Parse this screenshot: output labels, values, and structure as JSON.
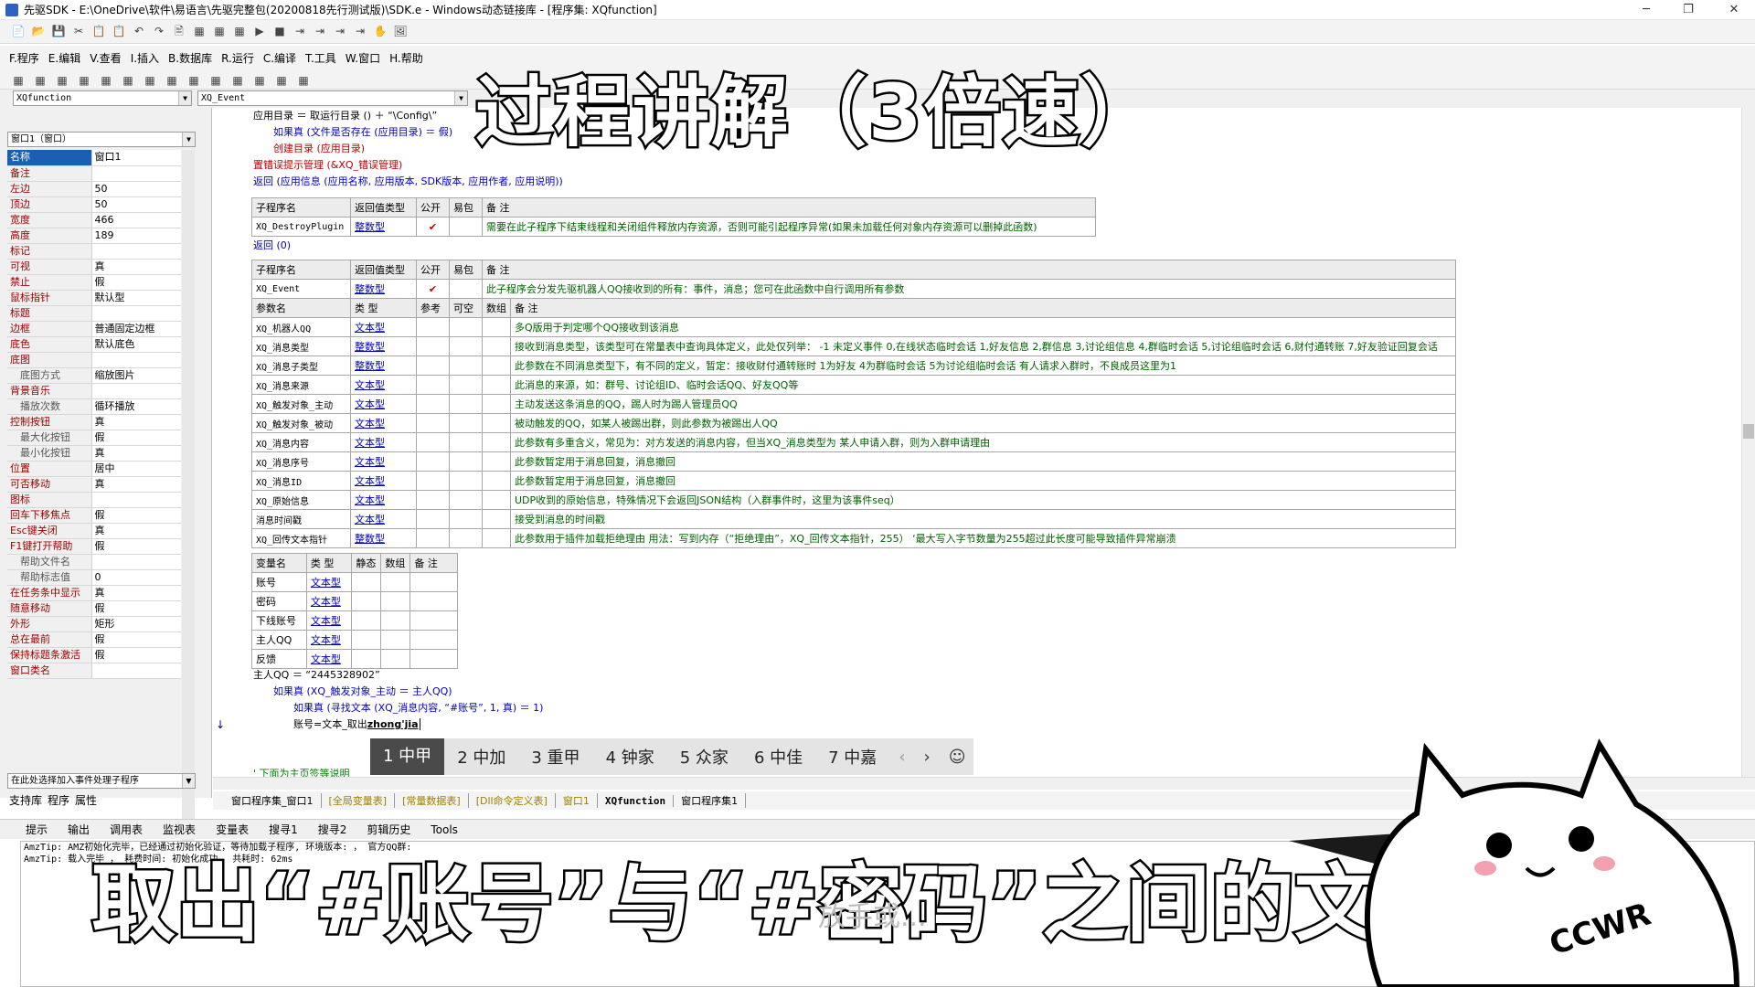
{
  "window": {
    "title": "先驱SDK - E:\\OneDrive\\软件\\易语言\\先驱完整包(20200818先行测试版)\\SDK.e - Windows动态链接库 - [程序集: XQfunction]",
    "min": "─",
    "max": "❐",
    "close": "✕"
  },
  "toolbar1": [
    "📄",
    "📂",
    "💾",
    "✂",
    "📋",
    "📋",
    "↶",
    "↷",
    "🖹",
    "▦",
    "▦",
    "▦",
    "▶",
    "■",
    "⇥",
    "⇥",
    "⇥",
    "⇥",
    "✋",
    "🖼"
  ],
  "menu": [
    "F.程序",
    "E.编辑",
    "V.查看",
    "I.插入",
    "B.数据库",
    "R.运行",
    "C.编译",
    "T.工具",
    "W.窗口",
    "H.帮助"
  ],
  "selectors": {
    "left": "XQfunction",
    "right": "XQ_Event"
  },
  "props": {
    "combo": "窗口1（窗口）",
    "rows": [
      {
        "n": "名称",
        "v": "窗口1",
        "sel": true
      },
      {
        "n": "备注",
        "v": ""
      },
      {
        "n": "左边",
        "v": "50"
      },
      {
        "n": "顶边",
        "v": "50"
      },
      {
        "n": "宽度",
        "v": "466"
      },
      {
        "n": "高度",
        "v": "189"
      },
      {
        "n": "标记",
        "v": ""
      },
      {
        "n": "可视",
        "v": "真"
      },
      {
        "n": "禁止",
        "v": "假"
      },
      {
        "n": "鼠标指针",
        "v": "默认型"
      },
      {
        "n": "标题",
        "v": ""
      },
      {
        "n": "边框",
        "v": "普通固定边框"
      },
      {
        "n": "底色",
        "v": "默认底色"
      },
      {
        "n": "底图",
        "v": ""
      },
      {
        "n": "底图方式",
        "v": "缩放图片",
        "sub": true
      },
      {
        "n": "背景音乐",
        "v": ""
      },
      {
        "n": "播放次数",
        "v": "循环播放",
        "sub": true
      },
      {
        "n": "控制按钮",
        "v": "真"
      },
      {
        "n": "最大化按钮",
        "v": "假",
        "sub": true
      },
      {
        "n": "最小化按钮",
        "v": "真",
        "sub": true
      },
      {
        "n": "位置",
        "v": "居中"
      },
      {
        "n": "可否移动",
        "v": "真"
      },
      {
        "n": "图标",
        "v": ""
      },
      {
        "n": "回车下移焦点",
        "v": "假"
      },
      {
        "n": "Esc键关闭",
        "v": "真"
      },
      {
        "n": "F1键打开帮助",
        "v": "假"
      },
      {
        "n": "帮助文件名",
        "v": "",
        "sub": true
      },
      {
        "n": "帮助标志值",
        "v": "0",
        "sub": true
      },
      {
        "n": "在任务条中显示",
        "v": "真"
      },
      {
        "n": "随意移动",
        "v": "假"
      },
      {
        "n": "外形",
        "v": "矩形"
      },
      {
        "n": "总在最前",
        "v": "假"
      },
      {
        "n": "保持标题条激活",
        "v": "假"
      },
      {
        "n": "窗口类名",
        "v": ""
      }
    ],
    "event_combo": "在此处选择加入事件处理子程序",
    "tabs": [
      "支持库",
      "程序",
      "属性"
    ]
  },
  "code": {
    "line1": "应用目录 ＝ 取运行目录 () ＋ “\\Config\\”",
    "line2": "如果真 (文件是否存在 (应用目录) ＝ 假)",
    "line3": "创建目录 (应用目录)",
    "line4": "置错误提示管理 (&XQ_错误管理)",
    "line5": "返回 (应用信息 (应用名称, 应用版本, SDK版本, 应用作者, 应用说明))",
    "ret0": "返回 (0)",
    "assign": "主人QQ ＝ “2445328902”",
    "if1": "如果真 (XQ_触发对象_主动 ＝ 主人QQ)",
    "if2": "如果真 (寻找文本 (XQ_消息内容, “#账号”, 1, 真) ＝ 1)",
    "typing": "账号=文本_取出",
    "ime_text": "zhong'jia",
    "cut_comment": "' 下面为主页签等说明"
  },
  "sub1": {
    "header": [
      "子程序名",
      "返回值类型",
      "公开",
      "易包",
      "备 注"
    ],
    "row": {
      "name": "XQ_DestroyPlugin",
      "type": "整数型",
      "public": "✔",
      "pkg": "",
      "note": "需要在此子程序下结束线程和关闭组件释放内存资源，否则可能引起程序异常(如果未加载任何对象内存资源可以删掉此函数)"
    }
  },
  "sub2": {
    "header": [
      "子程序名",
      "返回值类型",
      "公开",
      "易包",
      "备 注"
    ],
    "row": {
      "name": "XQ_Event",
      "type": "整数型",
      "public": "✔",
      "pkg": "",
      "note": "此子程序会分发先驱机器人QQ接收到的所有：事件，消息；您可在此函数中自行调用所有参数"
    },
    "param_header": [
      "参数名",
      "类 型",
      "参考",
      "可空",
      "数组",
      "备 注"
    ],
    "params": [
      {
        "name": "XQ_机器人QQ",
        "type": "文本型",
        "note": "多Q版用于判定哪个QQ接收到该消息"
      },
      {
        "name": "XQ_消息类型",
        "type": "整数型",
        "note": "接收到消息类型，该类型可在常量表中查询具体定义，此处仅列举： -1 未定义事件 0,在线状态临时会话 1,好友信息 2,群信息 3,讨论组信息 4,群临时会话 5,讨论组临时会话 6,财付通转账 7,好友验证回复会话"
      },
      {
        "name": "XQ_消息子类型",
        "type": "整数型",
        "note": "此参数在不同消息类型下，有不同的定义，暂定：接收财付通转账时 1为好友 4为群临时会话 5为讨论组临时会话    有人请求入群时，不良成员这里为1"
      },
      {
        "name": "XQ_消息来源",
        "type": "文本型",
        "note": "此消息的来源，如：群号、讨论组ID、临时会话QQ、好友QQ等"
      },
      {
        "name": "XQ_触发对象_主动",
        "type": "文本型",
        "note": "主动发送这条消息的QQ，踢人时为踢人管理员QQ"
      },
      {
        "name": "XQ_触发对象_被动",
        "type": "文本型",
        "note": "被动触发的QQ，如某人被踢出群，则此参数为被踢出人QQ"
      },
      {
        "name": "XQ_消息内容",
        "type": "文本型",
        "note": "此参数有多重含义，常见为：对方发送的消息内容，但当XQ_消息类型为 某人申请入群，则为入群申请理由"
      },
      {
        "name": "XQ_消息序号",
        "type": "文本型",
        "note": "此参数暂定用于消息回复，消息撤回"
      },
      {
        "name": "XQ_消息ID",
        "type": "文本型",
        "note": "此参数暂定用于消息回复，消息撤回"
      },
      {
        "name": "XQ_原始信息",
        "type": "文本型",
        "note": "UDP收到的原始信息，特殊情况下会返回JSON结构（入群事件时，这里为该事件seq）"
      },
      {
        "name": "消息时间戳",
        "type": "文本型",
        "note": "接受到消息的时间戳"
      },
      {
        "name": "XQ_回传文本指针",
        "type": "整数型",
        "note": "此参数用于插件加载拒绝理由  用法：写到内存（“拒绝理由”，XQ_回传文本指针，255） ‘最大写入字节数量为255超过此长度可能导致插件异常崩溃"
      }
    ]
  },
  "vars": {
    "header": [
      "变量名",
      "类 型",
      "静态",
      "数组",
      "备 注"
    ],
    "rows": [
      {
        "name": "账号",
        "type": "文本型"
      },
      {
        "name": "密码",
        "type": "文本型"
      },
      {
        "name": "下线账号",
        "type": "文本型"
      },
      {
        "name": "主人QQ",
        "type": "文本型"
      },
      {
        "name": "反馈",
        "type": "文本型"
      }
    ]
  },
  "ime": {
    "candidates": [
      "1 中甲",
      "2 中加",
      "3 重甲",
      "4 钟家",
      "5 众家",
      "6 中佳",
      "7 中嘉"
    ],
    "prev": "‹",
    "next": "›",
    "emoji": "☺"
  },
  "file_tabs": [
    "窗口程序集_窗口1",
    "[全局变量表]",
    "[常量数据表]",
    "[Dll命令定义表]",
    "窗口1",
    "XQfunction",
    "窗口程序集1"
  ],
  "bottom_tabs": [
    "提示",
    "输出",
    "调用表",
    "监视表",
    "变量表",
    "搜寻1",
    "搜寻2",
    "剪辑历史",
    "Tools"
  ],
  "output_lines": [
    "AmzTip: AMZ初始化完毕，已经通过初始化验证，等待加载子程序, 环境版本: ，   官方QQ群: ",
    "AmzTip: 载入完毕 ，   耗费时间: 初始化成功， 共耗时: 62ms"
  ],
  "overlay": {
    "title": "过程讲解（3倍速）",
    "subtitle": "取出“#账号”与“#密码”之间的文本",
    "hint": "放手或..."
  },
  "cat_caption": "CCWR"
}
